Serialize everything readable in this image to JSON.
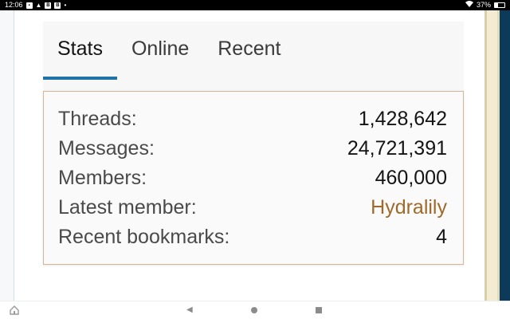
{
  "status_bar": {
    "time": "12:06",
    "notification_icons": [
      "image-icon",
      "alert-icon",
      "b-icon",
      "b-icon"
    ],
    "dot": "•",
    "battery_percent": "37%",
    "battery_level": 0.37
  },
  "tabs": [
    {
      "label": "Stats",
      "active": true
    },
    {
      "label": "Online",
      "active": false
    },
    {
      "label": "Recent",
      "active": false
    }
  ],
  "stats": [
    {
      "label": "Threads:",
      "value": "1,428,642"
    },
    {
      "label": "Messages:",
      "value": "24,721,391"
    },
    {
      "label": "Members:",
      "value": "460,000"
    },
    {
      "label": "Latest member:",
      "value": "Hydralily"
    },
    {
      "label": "Recent bookmarks:",
      "value": "4"
    }
  ],
  "colors": {
    "tab_accent": "#1f73a8",
    "link": "#a0692a",
    "box_border": "#d8b596"
  },
  "nav": {
    "icons": [
      "home-icon",
      "back-icon",
      "home-circle-icon",
      "recents-square-icon"
    ]
  }
}
